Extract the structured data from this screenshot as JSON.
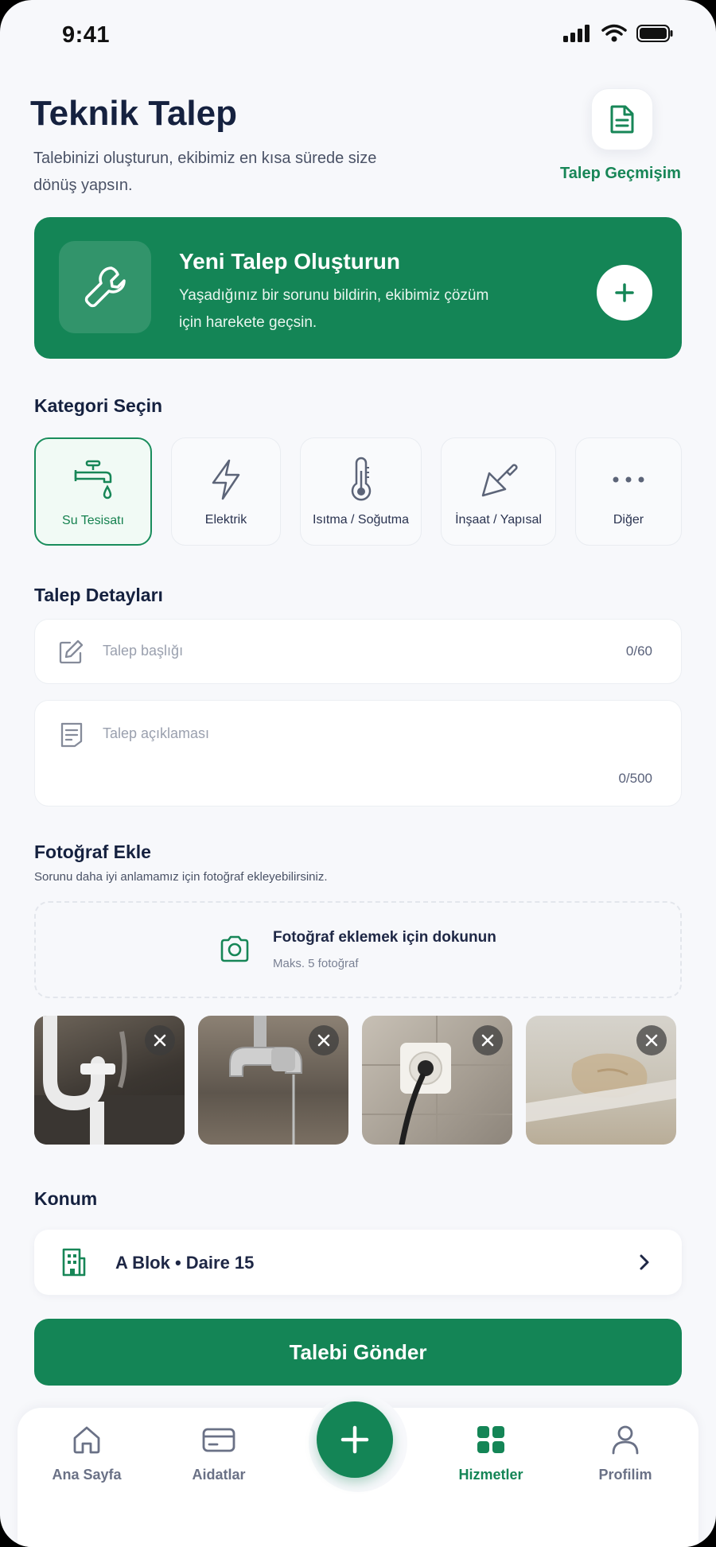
{
  "status_bar": {
    "time": "9:41"
  },
  "header": {
    "title": "Teknik Talep",
    "subtitle": "Talebinizi oluşturun, ekibimiz en kısa sürede size dönüş yapsın.",
    "history_label": "Talep Geçmişim",
    "history_icon": "document-icon"
  },
  "hero": {
    "title": "Yeni Talep Oluşturun",
    "desc": "Yaşadığınız bir sorunu bildirin, ekibimiz çözüm için harekete geçsin.",
    "icon": "wrench-icon"
  },
  "categories": {
    "title": "Kategori Seçin",
    "items": [
      {
        "label": "Su Tesisatı",
        "icon": "faucet-icon",
        "selected": true
      },
      {
        "label": "Elektrik",
        "icon": "lightning-icon",
        "selected": false
      },
      {
        "label": "Isıtma / Soğutma",
        "icon": "thermometer-icon",
        "selected": false
      },
      {
        "label": "İnşaat / Yapısal",
        "icon": "trowel-icon",
        "selected": false
      },
      {
        "label": "Diğer",
        "icon": "more-icon",
        "selected": false
      }
    ]
  },
  "details": {
    "title": "Talep Detayları",
    "title_placeholder": "Talep başlığı",
    "title_count": "0/60",
    "desc_placeholder": "Talep açıklaması",
    "desc_count": "0/500"
  },
  "photos": {
    "title": "Fotoğraf Ekle",
    "subtitle": "Sorunu daha iyi anlamamız için fotoğraf ekleyebilirsiniz.",
    "upload_title": "Fotoğraf eklemek için dokunun",
    "upload_sub": "Maks. 5 fotoğraf",
    "thumbs": [
      "sink-pipe-photo",
      "faucet-photo",
      "socket-photo",
      "wall-stain-photo"
    ]
  },
  "location": {
    "title": "Konum",
    "value": "A Blok • Daire 15"
  },
  "submit_label": "Talebi Gönder",
  "tabbar": {
    "items": [
      {
        "label": "Ana Sayfa",
        "icon": "home-icon"
      },
      {
        "label": "Aidatlar",
        "icon": "card-icon"
      },
      {
        "label": "Hizmetler",
        "icon": "grid-icon"
      },
      {
        "label": "Profilim",
        "icon": "user-icon"
      }
    ]
  },
  "colors": {
    "primary": "#148556",
    "text": "#15213f",
    "background": "#f7f8fb"
  }
}
